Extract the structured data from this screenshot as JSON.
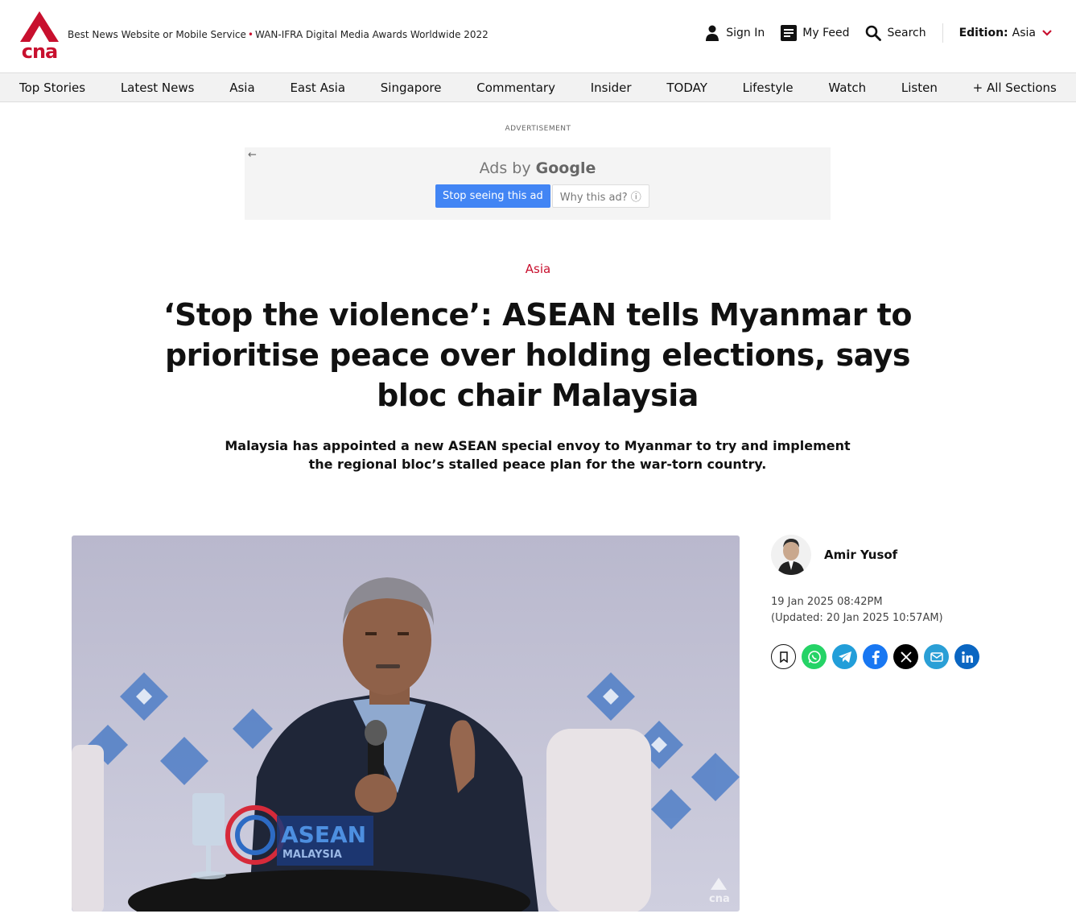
{
  "header": {
    "logo_text": "cna",
    "award_part1": "Best News Website or Mobile Service",
    "award_part2": "WAN-IFRA Digital Media Awards Worldwide 2022",
    "sign_in": "Sign In",
    "my_feed": "My Feed",
    "search": "Search",
    "edition_label": "Edition:",
    "edition_value": "Asia"
  },
  "nav": {
    "items": [
      "Top Stories",
      "Latest News",
      "Asia",
      "East Asia",
      "Singapore",
      "Commentary",
      "Insider",
      "TODAY",
      "Lifestyle",
      "Watch",
      "Listen",
      "+ All Sections"
    ]
  },
  "ad": {
    "label": "ADVERTISEMENT",
    "ads_by": "Ads by",
    "google": "Google",
    "stop": "Stop seeing this ad",
    "why": "Why this ad? ⓘ"
  },
  "article": {
    "category": "Asia",
    "headline": "‘Stop the violence’: ASEAN tells Myanmar to prioritise peace over holding elections, says bloc chair Malaysia",
    "summary": "Malaysia has appointed a new ASEAN special envoy to Myanmar to try and implement the regional bloc’s stalled peace plan for the war-torn country.",
    "image_watermark": "cna",
    "podium_text": "ASEAN",
    "podium_subtext": "MALAYSIA"
  },
  "sidebar": {
    "author": "Amir Yusof",
    "published": "19 Jan 2025 08:42PM",
    "updated": "(Updated: 20 Jan 2025 10:57AM)"
  },
  "colors": {
    "brand_red": "#c8102e",
    "whatsapp": "#25d366",
    "telegram": "#229ed9",
    "facebook": "#1877f2",
    "x": "#000000",
    "email": "#2a9fd6",
    "linkedin": "#0a66c2"
  }
}
